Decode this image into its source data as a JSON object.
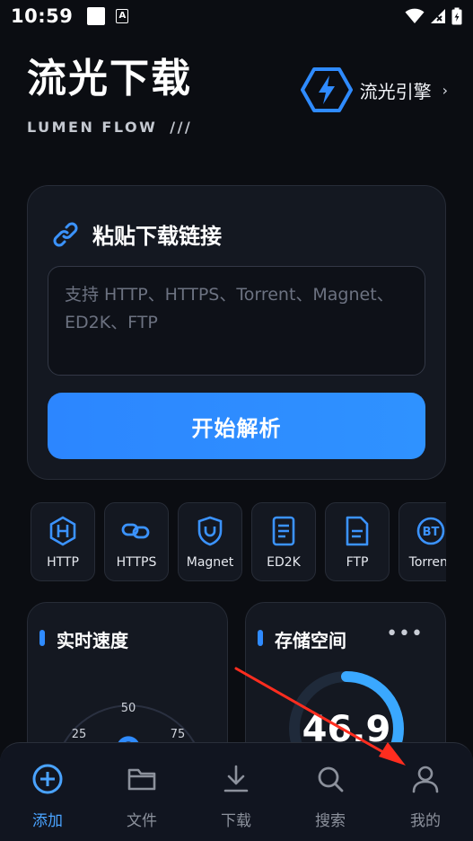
{
  "status_bar": {
    "time": "10:59",
    "a_icon_text": "A"
  },
  "header": {
    "title": "流光下载",
    "subtitle": "LUMEN FLOW",
    "subtitle_mark": "///",
    "engine_label": "流光引擎",
    "engine_arrow": "›"
  },
  "paste_card": {
    "title": "粘贴下载链接",
    "input_placeholder": "支持 HTTP、HTTPS、Torrent、Magnet、ED2K、FTP",
    "parse_button": "开始解析"
  },
  "protocols": [
    {
      "label": "HTTP",
      "icon": "http-icon"
    },
    {
      "label": "HTTPS",
      "icon": "https-icon"
    },
    {
      "label": "Magnet",
      "icon": "magnet-icon"
    },
    {
      "label": "ED2K",
      "icon": "ed2k-icon"
    },
    {
      "label": "FTP",
      "icon": "ftp-icon"
    },
    {
      "label": "Torrent",
      "icon": "bt-icon"
    }
  ],
  "speed_panel": {
    "title": "实时速度",
    "gauge_ticks": [
      "25",
      "50",
      "75"
    ]
  },
  "storage_panel": {
    "title": "存储空间",
    "more": "•••",
    "value": "46.9",
    "used_fraction": 0.58
  },
  "tabs": [
    {
      "label": "添加",
      "icon": "plus-circle-icon",
      "active": true
    },
    {
      "label": "文件",
      "icon": "folder-icon",
      "active": false
    },
    {
      "label": "下载",
      "icon": "download-icon",
      "active": false
    },
    {
      "label": "搜索",
      "icon": "search-icon",
      "active": false
    },
    {
      "label": "我的",
      "icon": "user-icon",
      "active": false
    }
  ],
  "colors": {
    "accent": "#2f8bff",
    "background": "#0b0d12",
    "card": "#141821",
    "annotation": "#ff2d1f"
  }
}
